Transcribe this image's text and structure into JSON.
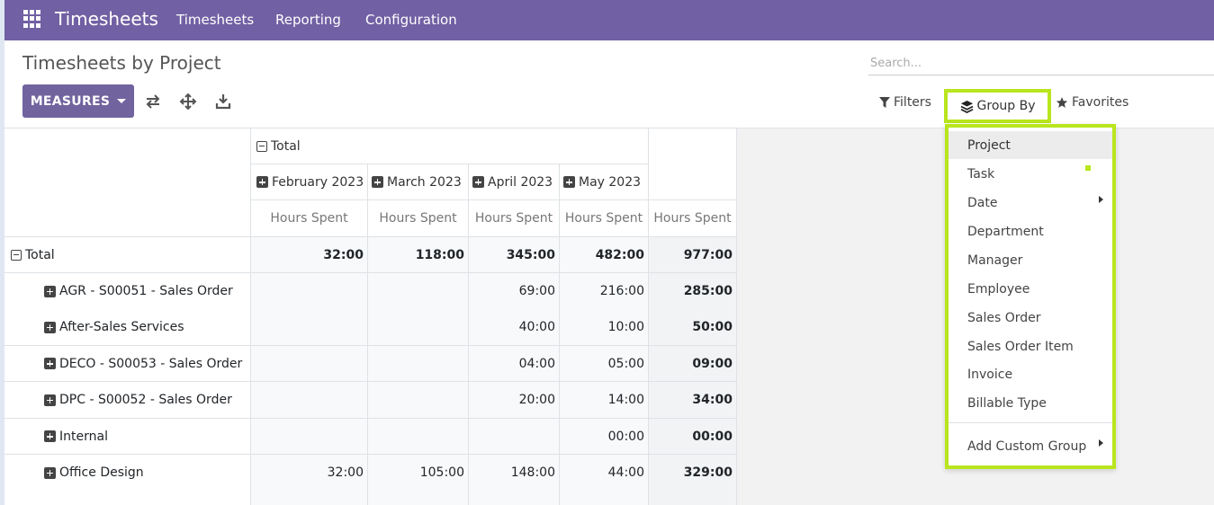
{
  "navbar": {
    "app_title": "Timesheets",
    "menu": [
      "Timesheets",
      "Reporting",
      "Configuration"
    ]
  },
  "control": {
    "breadcrumb": "Timesheets by Project",
    "measures_label": "MEASURES",
    "search_placeholder": "Search...",
    "filters_label": "Filters",
    "groupby_label": "Group By",
    "favorites_label": "Favorites"
  },
  "pivot": {
    "col_total_label": "Total",
    "months": [
      "February 2023",
      "March 2023",
      "April 2023",
      "May 2023"
    ],
    "measure_label": "Hours Spent",
    "total_row": {
      "label": "Total",
      "values": [
        "32:00",
        "118:00",
        "345:00",
        "482:00",
        "977:00"
      ]
    },
    "rows": [
      {
        "label": "AGR - S00051 - Sales Order",
        "values": [
          "",
          "",
          "69:00",
          "216:00",
          "285:00"
        ]
      },
      {
        "label": "After-Sales Services",
        "values": [
          "",
          "",
          "40:00",
          "10:00",
          "50:00"
        ]
      },
      {
        "label": "DECO - S00053 - Sales Order",
        "values": [
          "",
          "",
          "04:00",
          "05:00",
          "09:00"
        ]
      },
      {
        "label": "DPC - S00052 - Sales Order",
        "values": [
          "",
          "",
          "20:00",
          "14:00",
          "34:00"
        ]
      },
      {
        "label": "Internal",
        "values": [
          "",
          "",
          "",
          "00:00",
          "00:00"
        ]
      },
      {
        "label": "Office Design",
        "values": [
          "32:00",
          "105:00",
          "148:00",
          "44:00",
          "329:00"
        ]
      }
    ]
  },
  "groupby_menu": {
    "items": [
      "Project",
      "Task",
      "Date",
      "Department",
      "Manager",
      "Employee",
      "Sales Order",
      "Sales Order Item",
      "Invoice",
      "Billable Type"
    ],
    "custom_label": "Add Custom Group"
  },
  "colors": {
    "navbar": "#7160a3",
    "highlight": "#b9e51e",
    "button": "#71639e"
  }
}
